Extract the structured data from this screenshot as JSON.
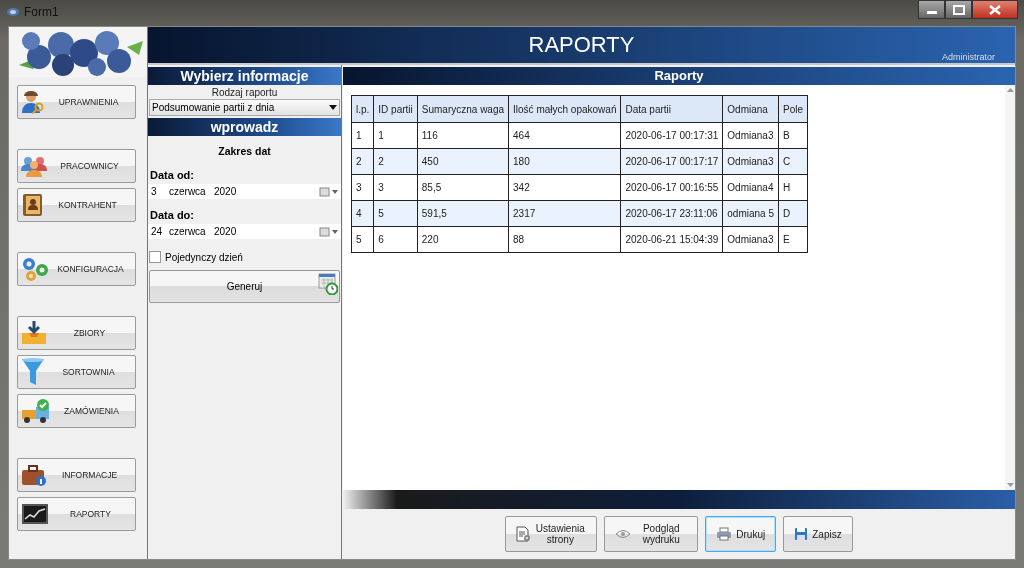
{
  "window": {
    "title": "Form1"
  },
  "header": {
    "title": "RAPORTY",
    "user": "Administrator"
  },
  "sidebar": {
    "groups": [
      [
        {
          "label": "UPRAWNIENIA"
        }
      ],
      [
        {
          "label": "PRACOWNICY"
        },
        {
          "label": "KONTRAHENT"
        }
      ],
      [
        {
          "label": "KONFIGURACJA"
        }
      ],
      [
        {
          "label": "ZBIORY"
        },
        {
          "label": "SORTOWNIA"
        },
        {
          "label": "ZAMÓWIENIA"
        }
      ],
      [
        {
          "label": "INFORMACJE"
        },
        {
          "label": "RAPORTY"
        }
      ]
    ]
  },
  "filter": {
    "title": "Wybierz informacje",
    "report_type_label": "Rodzaj raportu",
    "report_type": "Podsumowanie partii z dnia",
    "section_title": "wprowadz",
    "range_label": "Zakres dat",
    "date_from": {
      "label": "Data od:",
      "day": "3",
      "month": "czerwca",
      "year": "2020"
    },
    "date_to": {
      "label": "Data do:",
      "day": "24",
      "month": "czerwca",
      "year": "2020"
    },
    "single_day": {
      "label": "Pojedynczy dzień",
      "checked": false
    },
    "generate_button": "Generuj"
  },
  "results": {
    "title": "Raporty",
    "table": {
      "columns": [
        "l.p.",
        "ID partii",
        "Sumaryczna waga",
        "Ilość małych opakowań",
        "Data partii",
        "Odmiana",
        "Pole"
      ],
      "rows": [
        [
          "1",
          "1",
          "116",
          "464",
          "2020-06-17 00:17:31",
          "Odmiana3",
          "B"
        ],
        [
          "2",
          "2",
          "450",
          "180",
          "2020-06-17 00:17:17",
          "Odmiana3",
          "C"
        ],
        [
          "3",
          "3",
          "85,5",
          "342",
          "2020-06-17 00:16:55",
          "Odmiana4",
          "H"
        ],
        [
          "4",
          "5",
          "591,5",
          "2317",
          "2020-06-17 23:11:06",
          "odmiana 5",
          "D"
        ],
        [
          "5",
          "6",
          "220",
          "88",
          "2020-06-21 15:04:39",
          "Odmiana3",
          "E"
        ]
      ]
    },
    "buttons": [
      {
        "kind": "page-setup",
        "label": "Ustawienia strony",
        "focused": false
      },
      {
        "kind": "preview",
        "label": "Podgląd wydruku",
        "focused": false
      },
      {
        "kind": "print",
        "label": "Drukuj",
        "focused": true
      },
      {
        "kind": "save",
        "label": "Zapisz",
        "focused": false
      }
    ]
  }
}
